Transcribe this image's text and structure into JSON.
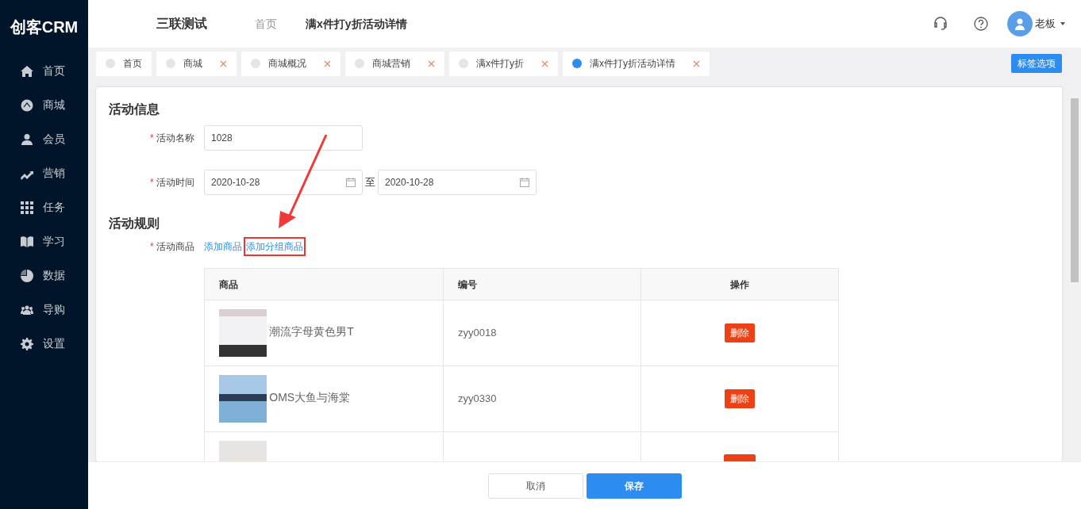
{
  "sidebar": {
    "logo": "创客CRM",
    "items": [
      {
        "label": "首页"
      },
      {
        "label": "商城"
      },
      {
        "label": "会员"
      },
      {
        "label": "营销"
      },
      {
        "label": "任务"
      },
      {
        "label": "学习"
      },
      {
        "label": "数据"
      },
      {
        "label": "导购"
      },
      {
        "label": "设置"
      }
    ]
  },
  "header": {
    "company": "三联测试",
    "breadcrumb": [
      {
        "label": "首页",
        "selected": false
      },
      {
        "label": "满x件打y折活动详情",
        "selected": true
      }
    ],
    "user": "老板"
  },
  "tabs": [
    {
      "label": "首页",
      "selected": false,
      "closable": false
    },
    {
      "label": "商城",
      "selected": false,
      "closable": true
    },
    {
      "label": "商城概况",
      "selected": false,
      "closable": true
    },
    {
      "label": "商城营销",
      "selected": false,
      "closable": true
    },
    {
      "label": "满x件打y折",
      "selected": false,
      "closable": true
    },
    {
      "label": "满x件打y折活动详情",
      "selected": true,
      "closable": true
    }
  ],
  "tab_options": "标签选项",
  "info": {
    "title": "活动信息",
    "required_mark": "*",
    "name_label": "活动名称",
    "name_value": "1028",
    "time_label": "活动时间",
    "start": "2020-10-28",
    "to": "至",
    "end": "2020-10-28"
  },
  "rules": {
    "title": "活动规则",
    "required_mark": "*",
    "goods_label": "活动商品",
    "links": [
      {
        "label": "添加商品",
        "highlighted": false
      },
      {
        "label": "添加分组商品",
        "highlighted": true
      }
    ]
  },
  "table": {
    "columns": [
      "商品",
      "编号",
      "操作"
    ],
    "rows": [
      {
        "name": "潮流字母黄色男T",
        "code": "zyy0018",
        "action": "删除"
      },
      {
        "name": "OMS大鱼与海棠",
        "code": "zyy0330",
        "action": "删除"
      },
      {}
    ]
  },
  "footer": {
    "buttons": [
      {
        "label": "取消",
        "kind": "secondary"
      },
      {
        "label": "保存",
        "kind": "primary"
      }
    ]
  }
}
